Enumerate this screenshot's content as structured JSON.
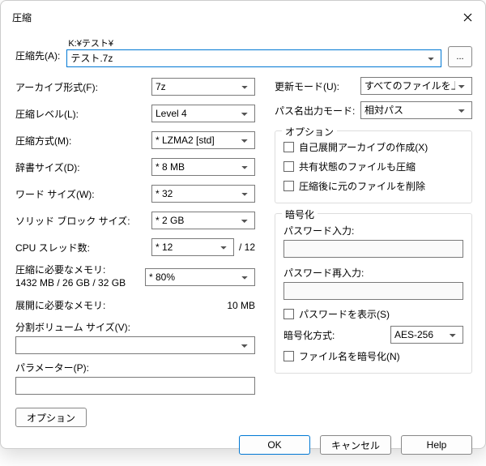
{
  "title": "圧縮",
  "archive": {
    "label": "圧縮先(A):",
    "path_prefix": "K:¥テスト¥",
    "value": "テスト.7z",
    "browse": "..."
  },
  "left": {
    "format": {
      "label": "アーカイブ形式(F):",
      "value": "7z"
    },
    "level": {
      "label": "圧縮レベル(L):",
      "value": "Level 4"
    },
    "method": {
      "label": "圧縮方式(M):",
      "value": "* LZMA2 [std]"
    },
    "dict": {
      "label": "辞書サイズ(D):",
      "value": "* 8 MB"
    },
    "word": {
      "label": "ワード サイズ(W):",
      "value": "* 32"
    },
    "solid": {
      "label": "ソリッド ブロック サイズ:",
      "value": "* 2 GB"
    },
    "cpu": {
      "label": "CPU スレッド数:",
      "value": "* 12",
      "total": "/ 12"
    },
    "mem": {
      "label1": "圧縮に必要なメモリ:",
      "label2": "1432 MB / 26 GB / 32 GB",
      "value": "* 80%"
    },
    "unpack": {
      "label": "展開に必要なメモリ:",
      "value": "10 MB"
    },
    "split": {
      "label": "分割ボリューム サイズ(V):",
      "value": ""
    },
    "param": {
      "label": "パラメーター(P):",
      "value": ""
    },
    "option_btn": "オプション"
  },
  "right": {
    "update": {
      "label": "更新モード(U):",
      "value": "すべてのファイルを上書き"
    },
    "pathmode": {
      "label": "パス名出力モード:",
      "value": "相対パス"
    },
    "options_group": {
      "title": "オプション",
      "sfx": "自己展開アーカイブの作成(X)",
      "shared": "共有状態のファイルも圧縮",
      "delete": "圧縮後に元のファイルを削除"
    },
    "enc_group": {
      "title": "暗号化",
      "pw_label": "パスワード入力:",
      "pw2_label": "パスワード再入力:",
      "show_pw": "パスワードを表示(S)",
      "method_label": "暗号化方式:",
      "method_value": "AES-256",
      "encrypt_names": "ファイル名を暗号化(N)"
    }
  },
  "footer": {
    "ok": "OK",
    "cancel": "キャンセル",
    "help": "Help"
  }
}
